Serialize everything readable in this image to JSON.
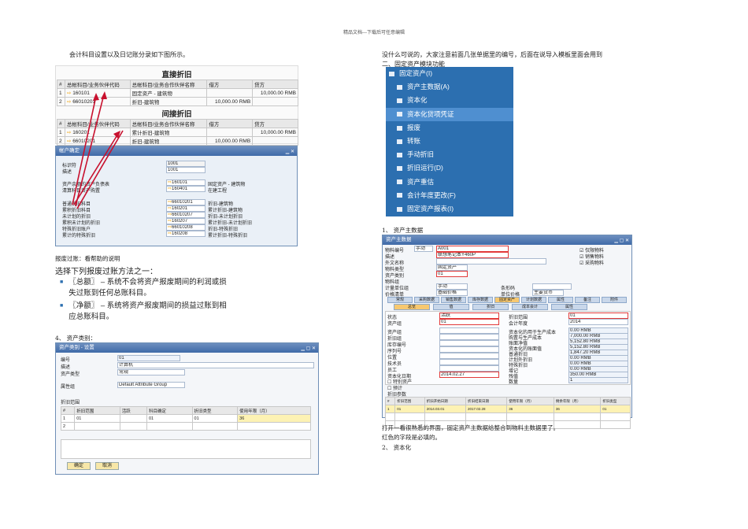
{
  "header": "精品文档---下载后可任意编辑",
  "left": {
    "intro": "会计科目设置以及日记账分录如下图所示。",
    "direct_title": "直接折旧",
    "indirect_title": "间接折旧",
    "cols": [
      "#",
      "总帐科目/业务伙伴代码",
      "总帐科目/业务合作伙伴名称",
      "借方",
      "贷方"
    ],
    "direct_rows": [
      [
        "1",
        "160101",
        "固定资产 - 建筑物",
        "",
        "10,000.00 RMB"
      ],
      [
        "2",
        "66010201",
        "折旧-建筑物",
        "10,000.00 RMB",
        ""
      ]
    ],
    "indirect_rows": [
      [
        "1",
        "160201",
        "累计折旧-建筑物",
        "",
        "10,000.00 RMB"
      ],
      [
        "2",
        "66010201",
        "折旧-建筑物",
        "10,000.00 RMB",
        ""
      ]
    ],
    "acct_window": {
      "title": "帐户确定",
      "fields": [
        {
          "label": "标识符",
          "code": "1001",
          "name": ""
        },
        {
          "label": "描述",
          "code": "1001",
          "name": ""
        },
        {
          "label": "资产余额的资产负债表",
          "code": "160101",
          "name": "固定资产 - 建筑物"
        },
        {
          "label": "清算科目资产购置",
          "code": "160401",
          "name": "在建工程"
        },
        {
          "label": "普通折旧科目",
          "code": "66010201",
          "name": "折旧-建筑物"
        },
        {
          "label": "累积折旧科目",
          "code": "160201",
          "name": "累计折旧-建筑物"
        },
        {
          "label": "未计划的折旧",
          "code": "66010207",
          "name": "折旧-未计划折旧"
        },
        {
          "label": "累积未计划的折旧",
          "code": "160207",
          "name": "累计折旧-未计划折旧"
        },
        {
          "label": "特殊折旧账户",
          "code": "66010208",
          "name": "折旧-特殊折旧"
        },
        {
          "label": "累计的特殊折旧",
          "code": "160208",
          "name": "累计折旧-特殊折旧"
        }
      ]
    },
    "scrap_note": "报废过账：看帮助的说明",
    "scrap_title": "选择下列报废过账方法之一：",
    "bullets": [
      "〖总额〗 – 系统不会将资产报废期间的利润或损失过账到任何总账科目。",
      "〖净额〗 – 系统将资产报废期间的损益过账到相应总账科目。"
    ],
    "class_heading": "4、 资产类别：",
    "class_window": {
      "title": "资产类别 - 设置",
      "code_label": "编号",
      "code": "01",
      "desc_label": "描述",
      "desc": "计算机",
      "type_label": "资产类型",
      "type": "常规",
      "attr_label": "属性组",
      "attr": "Default Attribute Group",
      "range_label": "折旧范围",
      "cols": [
        "#",
        "折旧范围",
        "活跃",
        "科目确定",
        "折旧类型",
        "使用年限（月）"
      ],
      "rows": [
        [
          "1",
          "01",
          "",
          "01",
          "01",
          "36"
        ],
        [
          "2",
          "",
          "",
          "",
          "",
          ""
        ]
      ],
      "ok": "确定",
      "cancel": "取消"
    }
  },
  "right": {
    "intro": "没什么可说的，大家注意前面几张单据里的编号，后面在说导入模板里面会用到",
    "module_heading": "二、固定资产模块功能",
    "menu": [
      "固定资产(I)",
      "资产主数据(A)",
      "资本化",
      "资本化贷项凭证",
      "报废",
      "转账",
      "手动折旧",
      "折旧运行(D)",
      "资产重估",
      "会计年度更改(F)",
      "固定资产报表(I)"
    ],
    "master_heading": "1、 资产主数据",
    "master": {
      "title": "资产主数据",
      "item_no_label": "物料编号",
      "manual": "手动",
      "item_no": "A001",
      "desc_label": "描述",
      "desc": "联想笔记本Y460P",
      "fgn_label": "外文名称",
      "type_label": "物料类型",
      "type": "固定资产",
      "class_label": "资产类别",
      "class": "01",
      "group_label": "物料组",
      "price_label": "价格清单",
      "price": "基础价格",
      "uom_label": "计量单位组",
      "uom": "手动",
      "barcode_label": "条形码",
      "unit_price_label": "单位价格",
      "currency": "主要货币",
      "checks": [
        "仅限物料",
        "销售物料",
        "采购物料"
      ],
      "tabs": [
        "常规",
        "采购数据",
        "销售数据",
        "库存数据",
        "固定资产",
        "计划数据",
        "属性",
        "备注",
        "附件"
      ],
      "subtabs": [
        "总览",
        "值",
        "折旧",
        "成本会计",
        "属性"
      ],
      "status_label": "状态",
      "status": "活跃",
      "group2_label": "资产组",
      "group2": "01",
      "acct_label": "折旧范围",
      "acct": "01",
      "year_label": "会计年度",
      "year": "2014",
      "left_fields": [
        "资产组",
        "折旧组",
        "库存编号",
        "序列号",
        "位置",
        "技术员",
        "员工",
        "资本化日期"
      ],
      "cap_date": "2014.02.27",
      "checks2": [
        "特别资产",
        "预计"
      ],
      "right_fields": [
        [
          "资本化的用于生产成本",
          "0.00 RMB"
        ],
        [
          "购置与生产成本",
          "7,000.00 RMB"
        ],
        [
          "账面净值",
          "5,152.80 RMB"
        ],
        [
          "资本化的账面值",
          "5,152.80 RMB"
        ],
        [
          "普通折旧",
          "1,847.20 RMB"
        ],
        [
          "计划外折旧",
          "0.00 RMB"
        ],
        [
          "特殊折旧",
          "0.00 RMB"
        ],
        [
          "增记",
          "0.00 RMB"
        ],
        [
          "残值",
          "350.00 RMB"
        ],
        [
          "数量",
          "1"
        ]
      ],
      "dep_label": "折旧参数",
      "dep_cols": [
        "#",
        "折旧范围",
        "折旧开始日期",
        "折旧结束日期",
        "使用年限（月）",
        "剩余年限（月）",
        "折旧类型"
      ],
      "dep_rows": [
        [
          "1",
          "01",
          "2014.03.01",
          "2017.02.28",
          "36",
          "36",
          "01"
        ]
      ]
    },
    "note1": "打开一看很熟悉的界面，固定资产主数据给整合到物料主数据里了。",
    "note2": "红色的字段是必填的。",
    "cap_heading": "2、 资本化"
  }
}
